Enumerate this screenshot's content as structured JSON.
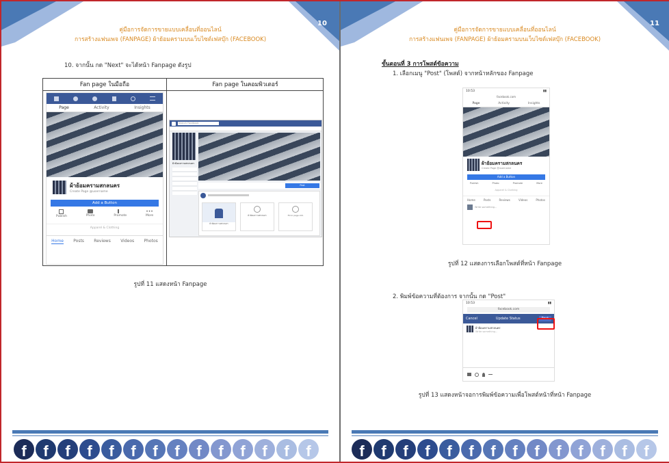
{
  "colors": {
    "frame": "#c0262b",
    "header_title": "#d98a22",
    "fb_blue": "#3b5998",
    "footer_blue": "#4a79b5"
  },
  "left_page": {
    "page_number": "10",
    "header_line1": "คู่มือการจัดการขายแบบเคลื่อนที่ออนไลน์",
    "header_line2": "การสร้างแฟนเพจ (FANPAGE) ผ้าย้อมครามบนเว็บไซต์เฟสบุ๊ก (FACEBOOK)",
    "step_text": "10. จากนั้น กด \"Next\" จะได้หน้า Fanpage ดังรูป",
    "table_header_mobile": "Fan page ในมือถือ",
    "table_header_desktop": "Fan page ในคอมพิวเตอร์",
    "mobile": {
      "tabs": [
        "Page",
        "Activity",
        "Insights"
      ],
      "page_name": "ผ้าย้อมครามสกลนคร",
      "page_sub": "Create Page @username",
      "add_button": "Add a Button",
      "actions": [
        "Publish",
        "Photo",
        "Promote",
        "More"
      ],
      "category": "Apparel & Clothing",
      "bottom_tabs": [
        "Home",
        "Posts",
        "Reviews",
        "Videos",
        "Photos"
      ]
    },
    "desktop": {
      "search_placeholder": "Search Facebook",
      "page_name": "ผ้าย้อมครามสกลนคร",
      "post_button": "Post",
      "card1_caption": "ผ้าย้อมครามสกลนคร",
      "card2_caption": "ผ้าย้อมครามสกลนคร",
      "card_text": "Fill in page info"
    },
    "caption": "รูปที่ 11 แสดงหน้า Fanpage"
  },
  "right_page": {
    "page_number": "11",
    "header_line1": "คู่มือการจัดการขายแบบเคลื่อนที่ออนไลน์",
    "header_line2": "การสร้างแฟนเพจ (FANPAGE) ผ้าย้อมครามบนเว็บไซต์เฟสบุ๊ก (FACEBOOK)",
    "section_title": "ขั้นตอนที่ 3 การโพสต์ข้อความ",
    "step1_text": "1. เลือกเมนู \"Post\" (โพสต์) จากหน้าหลักของ Fanpage",
    "phone1": {
      "time": "10:53",
      "url": "facebook.com",
      "tabs": [
        "Page",
        "Activity",
        "Insights"
      ],
      "page_name": "ผ้าย้อมครามสกลนคร",
      "page_sub": "Create Page @username",
      "add_button": "Add a Button",
      "actions": [
        "Publish",
        "Photo",
        "Promote",
        "More"
      ],
      "category": "Apparel & Clothing",
      "bottom_tabs": [
        "Home",
        "Posts",
        "Reviews",
        "Videos",
        "Photos"
      ],
      "composer": "Write something..."
    },
    "caption1": "รูปที่ 12 แสดงการเลือกโพสต์ที่หน้า Fanpage",
    "step2_text": "2. พิมพ์ข้อความที่ต้องการ จากนั้น กด \"Post\"",
    "phone2": {
      "time": "10:53",
      "url": "facebook.com",
      "cancel": "Cancel",
      "title": "Update Status",
      "post": "Post",
      "author": "ผ้าย้อมครามสกลนคร",
      "placeholder": "Write something..."
    },
    "caption2": "รูปที่ 13 แสดงหน้าจอการพิมพ์ข้อความเพื่อโพสต์หน้าที่หน้า Fanpage"
  },
  "footer": {
    "logo_glyph": "f",
    "logo_colors": [
      "#1c2c58",
      "#1f3a70",
      "#243f7a",
      "#2d4c8e",
      "#3a5c9e",
      "#4a6aad",
      "#5676b6",
      "#6581c0",
      "#7289c6",
      "#8397cf",
      "#90a3d6",
      "#9eb0dc",
      "#aabde2",
      "#b6c7e8"
    ]
  }
}
